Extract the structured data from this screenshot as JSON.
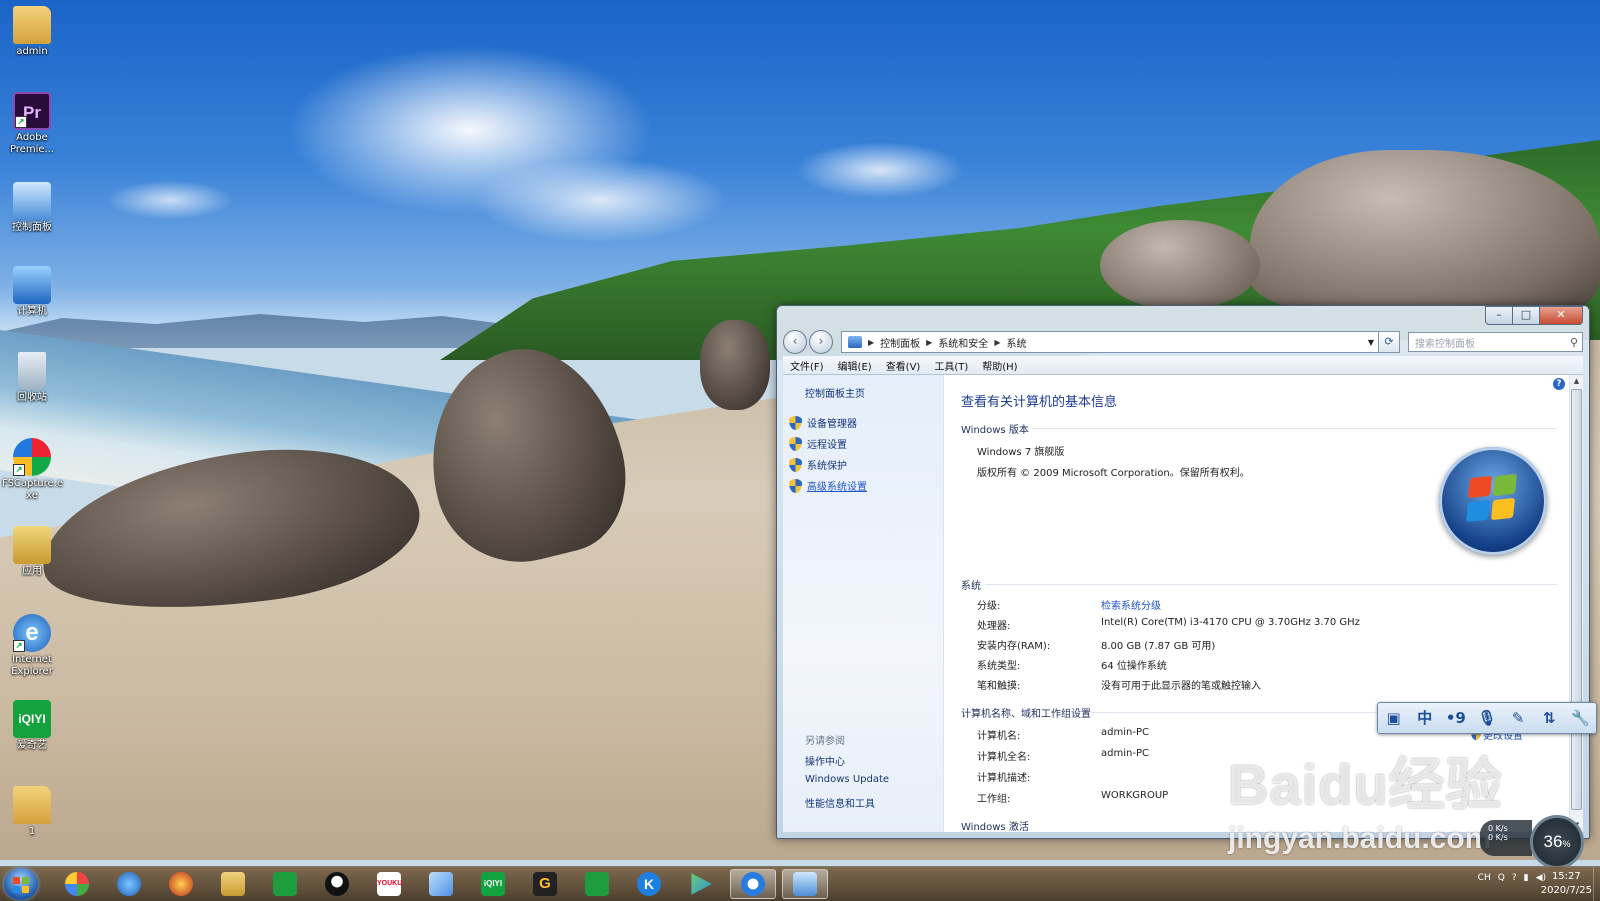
{
  "desktop": {
    "icons": [
      {
        "label": "admin",
        "icon": "user-folder-icon"
      },
      {
        "label": "Adobe Premie...",
        "icon": "premiere-icon"
      },
      {
        "label": "控制面板",
        "icon": "control-panel-icon"
      },
      {
        "label": "计算机",
        "icon": "computer-icon"
      },
      {
        "label": "回收站",
        "icon": "recycle-bin-icon"
      },
      {
        "label": "FSCapture.e xe",
        "icon": "fscapture-icon"
      },
      {
        "label": "应用",
        "icon": "folder-icon"
      },
      {
        "label": "Internet Explorer",
        "icon": "ie-icon"
      },
      {
        "label": "爱奇艺",
        "icon": "iqiyi-icon"
      },
      {
        "label": "1",
        "icon": "folder-icon"
      }
    ],
    "pr_glyph": "Pr",
    "ie_glyph": "e",
    "iqiyi_glyph": "iQIYI"
  },
  "window": {
    "address": {
      "crumbs": [
        "控制面板",
        "系统和安全",
        "系统"
      ],
      "search_placeholder": "搜索控制面板"
    },
    "menu": [
      "文件(F)",
      "编辑(E)",
      "查看(V)",
      "工具(T)",
      "帮助(H)"
    ],
    "left_pane": {
      "home": "控制面板主页",
      "links": [
        "设备管理器",
        "远程设置",
        "系统保护",
        "高级系统设置"
      ],
      "see_also_title": "另请参阅",
      "see_also": [
        "操作中心",
        "Windows Update",
        "性能信息和工具"
      ]
    },
    "main": {
      "title": "查看有关计算机的基本信息",
      "edition_section": "Windows 版本",
      "edition": "Windows 7 旗舰版",
      "copyright": "版权所有 © 2009 Microsoft Corporation。保留所有权利。",
      "system_section": "系统",
      "system_rows": [
        {
          "label": "分级:",
          "value": "检索系统分级",
          "link": true
        },
        {
          "label": "处理器:",
          "value": "Intel(R) Core(TM) i3-4170 CPU @ 3.70GHz   3.70 GHz"
        },
        {
          "label": "安装内存(RAM):",
          "value": "8.00 GB (7.87 GB 可用)"
        },
        {
          "label": "系统类型:",
          "value": "64 位操作系统"
        },
        {
          "label": "笔和触摸:",
          "value": "没有可用于此显示器的笔或触控输入"
        }
      ],
      "name_section": "计算机名称、域和工作组设置",
      "change_settings": "更改设置",
      "name_rows": [
        {
          "label": "计算机名:",
          "value": "admin-PC"
        },
        {
          "label": "计算机全名:",
          "value": "admin-PC"
        },
        {
          "label": "计算机描述:",
          "value": ""
        },
        {
          "label": "工作组:",
          "value": "WORKGROUP"
        }
      ],
      "activation_section": "Windows 激活"
    }
  },
  "ime_toolbar": {
    "items": [
      "screenshot-icon",
      "中",
      "•9",
      "microphone-icon",
      "handwrite-icon",
      "switch-icon",
      "wrench-icon"
    ],
    "lang_label": "中",
    "punct_label": "•9"
  },
  "watermark": {
    "brand": "Baidu经验",
    "url": "jingyan.baidu.com"
  },
  "gauge": {
    "value": "36",
    "unit": "%",
    "up": "0 K/s",
    "down": "0 K/s"
  },
  "taskbar": {
    "apps": [
      "photos-icon",
      "ie-icon",
      "game-icon",
      "explorer-icon",
      "green-app-icon",
      "qq-icon",
      "youku-icon",
      "feather-icon",
      "iqiyi-icon",
      "g-app-icon",
      "green-app2-icon",
      "k-app-icon",
      "media-player-icon",
      "browser-icon",
      "control-panel-icon"
    ],
    "tray": [
      "CH",
      "Q",
      "?",
      "network-icon",
      "volume-icon"
    ],
    "time": "15:27",
    "date": "2020/7/25",
    "iqiyi_glyph": "iQIYI",
    "youku_glyph": "YOUKU",
    "g_glyph": "G",
    "k_glyph": "K"
  },
  "colors": {
    "accent": "#1e3c96",
    "link": "#1f54c6",
    "taskbar": "#6b5438"
  }
}
